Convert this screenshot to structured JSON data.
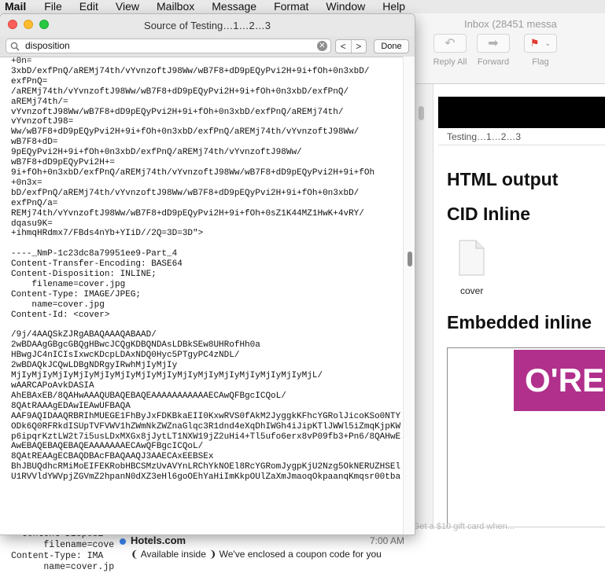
{
  "menubar": {
    "app": "Mail",
    "items": [
      "File",
      "Edit",
      "View",
      "Mailbox",
      "Message",
      "Format",
      "Window",
      "Help"
    ]
  },
  "mail_window": {
    "title": "Inbox (28451 messa",
    "toolbar": {
      "reply_all": "Reply All",
      "forward": "Forward",
      "flag": "Flag"
    },
    "message": {
      "subject": "Testing…1…2…3",
      "heading_html_output": "HTML output",
      "heading_cid_inline": "CID Inline",
      "attachment_label": "cover",
      "heading_embedded": "Embedded inline",
      "image_text": "O'RE"
    },
    "bottom_source_lines": "  Content-Disposi\n      filename=cove\nContent-Type: IMA\n      name=cover.jp",
    "list_item": {
      "faded_text": "18:  Hotels.com  your Free Delivery by 12/20 ✦  Get a $10 gift card when...",
      "sender": "Hotels.com",
      "time": "7:00 AM",
      "preview": "❨ Available inside ❩ We've enclosed a coupon code for you"
    }
  },
  "source_window": {
    "title": "Source of Testing…1…2…3",
    "search_value": "disposition",
    "done_label": "Done",
    "prev_label": "<",
    "next_label": ">",
    "content": "+0n=\n3xbD/exfPnQ/aREMj74th/vYvnzoftJ98Ww/wB7F8+dD9pEQyPvi2H+9i+fOh+0n3xbD/\nexfPnQ=\n/aREMj74th/vYvnzoftJ98Ww/wB7F8+dD9pEQyPvi2H+9i+fOh+0n3xbD/exfPnQ/\naREMj74th/=\nvYvnzoftJ98Ww/wB7F8+dD9pEQyPvi2H+9i+fOh+0n3xbD/exfPnQ/aREMj74th/\nvYvnzoftJ98=\nWw/wB7F8+dD9pEQyPvi2H+9i+fOh+0n3xbD/exfPnQ/aREMj74th/vYvnzoftJ98Ww/\nwB7F8+dD=\n9pEQyPvi2H+9i+fOh+0n3xbD/exfPnQ/aREMj74th/vYvnzoftJ98Ww/\nwB7F8+dD9pEQyPvi2H+=\n9i+fOh+0n3xbD/exfPnQ/aREMj74th/vYvnzoftJ98Ww/wB7F8+dD9pEQyPvi2H+9i+fOh\n+0n3x=\nbD/exfPnQ/aREMj74th/vYvnzoftJ98Ww/wB7F8+dD9pEQyPvi2H+9i+fOh+0n3xbD/\nexfPnQ/a=\nREMj74th/vYvnzoftJ98Ww/wB7F8+dD9pEQyPvi2H+9i+fOh+0sZ1K44MZ1HwK+4vRY/\ndqasu9K=\n+ihmqHRdmx7/FBds4nYb+YIiD//2Q=3D=3D\">\n\n----_NmP-1c23dc8a79951ee9-Part_4\nContent-Transfer-Encoding: BASE64\nContent-Disposition: INLINE;\n    filename=cover.jpg\nContent-Type: IMAGE/JPEG;\n    name=cover.jpg\nContent-Id: <cover>\n\n/9j/4AAQSkZJRgABAQAAAQABAAD/\n2wBDAAgGBgcGBQgHBwcJCQgKDBQNDAsLDBkSEw8UHRofHh0a\nHBwgJC4nICIsIxwcKDcpLDAxNDQ0Hyc5PTgyPC4zNDL/\n2wBDAQkJCQwLDBgNDRgyIRwhMjIyMjIy\nMjIyMjIyMjIyMjIyMjIyMjIyMjIyMjIyMjIyMjIyMjIyMjIyMjIyMjIyMjL/\nwAARCAPoAvkDASIA\nAhEBAxEB/8QAHwAAAQUBAQEBAQEAAAAAAAAAAAECAwQFBgcICQoL/\n8QAtRAAAgEDAwIEAwUFBAQA\nAAF9AQIDAAQRBRIhMUEGE1FhByJxFDKBkaEII0KxwRVS0fAkM2JyggkKFhcYGRolJicoKSo0NTY3\nODk6Q0RFRkdISUpTVFVWV1hZWmNkZWZnaGlqc3R1dnd4eXqDhIWGh4iJipKTlJWWl5iZmqKjpKWm\np6ipqrKztLW2t7i5usLDxMXGx8jJytLT1NXW19jZ2uHi4+Tl5ufo6erx8vP09fb3+Pn6/8QAHwEA\nAwEBAQEBAQEBAQEAAAAAAAECAwQFBgcICQoL/\n8QAtREAAgECBAQDBAcFBAQAAQJ3AAECAxEEBSEx\nBhJBUQdhcRMiMoEIFEKRobHBCSMzUvAVYnLRChYkNOEl8RcYGRomJygpKjU2Nzg5OkNERUZHSElK\nU1RVVldYWVpjZGVmZ2hpanN0dXZ3eHl6goOEhYaHiImKkpOUlZaXmJmaoqOkpaanqKmqsr00tba3"
  }
}
